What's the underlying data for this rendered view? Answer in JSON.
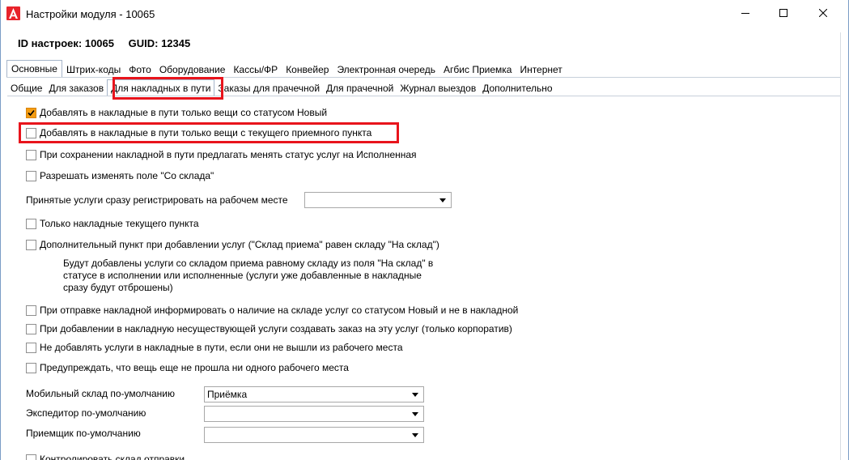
{
  "window": {
    "title": "Настройки модуля  - 10065",
    "icon": "app-logo-icon",
    "accent": "#e8232b"
  },
  "header": {
    "id_label": "ID настроек: 10065",
    "guid_label": "GUID: 12345"
  },
  "tabs_main": [
    "Основные",
    "Штрих-коды",
    "Фото",
    "Оборудование",
    "Кассы/ФР",
    "Конвейер",
    "Электронная очередь",
    "Агбис Приемка",
    "Интернет"
  ],
  "tabs_sub": [
    "Общие",
    "Для заказов",
    "Для накладных в пути",
    "Заказы для прачечной",
    "Для прачечной",
    "Журнал выездов",
    "Дополнительно"
  ],
  "options": {
    "opt1": "Добавлять в накладные в пути только вещи со статусом Новый",
    "opt2": "Добавлять в накладные в пути только вещи с текущего приемного пункта",
    "opt3": "При сохранении накладной в пути предлагать менять статус услуг на Исполненная",
    "opt4": "Разрешать изменять поле \"Со склада\"",
    "register_label": "Принятые услуги сразу регистрировать на рабочем месте",
    "opt5": "Только накладные текущего пункта",
    "opt6": "Дополнительный пункт при добавлении услуг (\"Склад приема\" равен складу \"На склад\")",
    "note_line1": "Будут добавлены услуги со складом приема равному складу из поля \"На склад\" в",
    "note_line2": "статусе в исполнении или исполненные (услуги уже добавленные в накладные",
    "note_line3": "сразу будут отброшены)",
    "opt7": "При отправке накладной информировать о наличие на складе услуг со статусом Новый и не в накладной",
    "opt8": "При добавлении в накладную несуществующей услуги создавать заказ на эту услуг (только корпоратив)",
    "opt9": "Не добавлять услуги в накладные в пути, если они не вышли из рабочего места",
    "opt10": "Предупреждать, что вещь еще не прошла ни одного рабочего места",
    "mobile_label": "Мобильный склад по-умолчанию",
    "mobile_value": "Приёмка",
    "expeditor_label": "Экспедитор по-умолчанию",
    "expeditor_value": "",
    "receiver_label": "Приемщик по-умолчанию",
    "receiver_value": "",
    "opt11": "Контролировать склад отправки"
  },
  "checked": {
    "opt1": true
  }
}
